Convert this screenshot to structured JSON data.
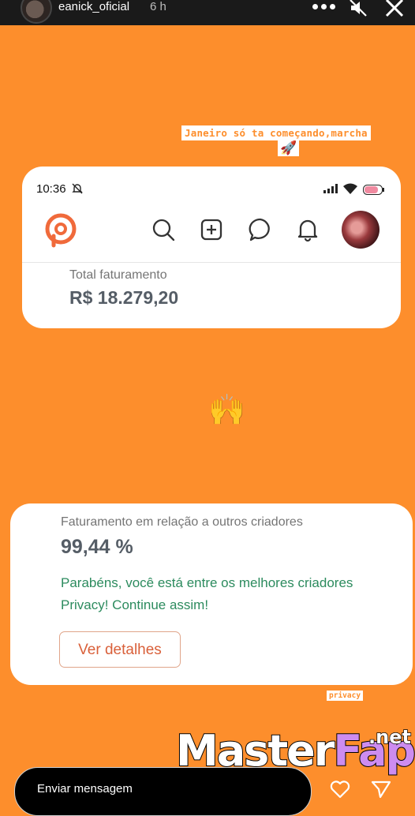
{
  "header": {
    "username": "eanick_oficial",
    "time_ago": "6 h",
    "more_icon": "more-horizontal-icon",
    "mute_icon": "speaker-muted-icon",
    "close_icon": "close-icon"
  },
  "story": {
    "caption": "Janeiro só ta começando,marcha",
    "caption_emoji": "🚀",
    "center_emoji": "🙌",
    "sticker_tag": "privacy"
  },
  "phone_card": {
    "status_time": "10:36",
    "battery": "75",
    "total_label": "Total faturamento",
    "total_value": "R$ 18.279,20",
    "nav_icons": [
      "search-icon",
      "add-post-icon",
      "chat-icon",
      "bell-icon"
    ]
  },
  "ranking_card": {
    "label": "Faturamento em relação a outros criadores",
    "value": "99,44 %",
    "congrats": "Parabéns, você está entre os melhores criadores Privacy! Continue assim!",
    "details_button": "Ver detalhes"
  },
  "footer": {
    "message_placeholder": "Enviar mensagem"
  },
  "watermark": {
    "part1": "Master",
    "part2": "Fap",
    "suffix": ".net"
  },
  "colors": {
    "background": "#fd8e2c",
    "accent_green": "#2c8b5e",
    "button_text": "#d9603a",
    "watermark_purple": "#cd8cf0"
  }
}
